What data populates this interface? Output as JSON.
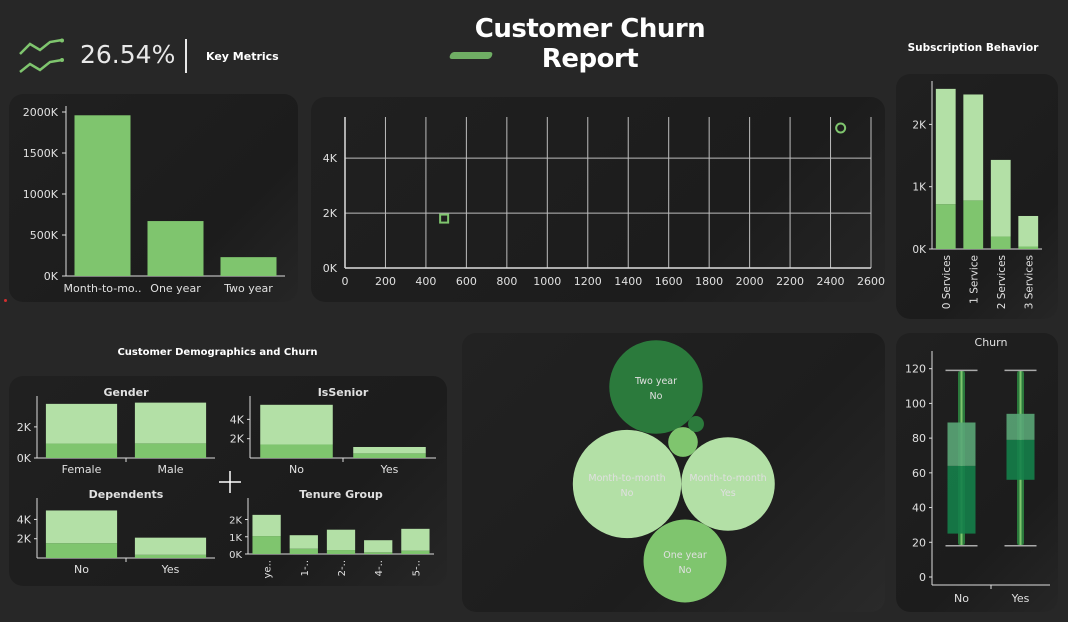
{
  "header": {
    "title": "Customer Churn Report",
    "kpi_value": "26.54%",
    "kpi_label": "Key Metrics",
    "subscription_title": "Subscription Behavior",
    "demographics_title": "Customer Demographics and Churn"
  },
  "colors": {
    "light": "#b3e0a6",
    "mid": "#7fc56e",
    "dark": "#2b7a3c",
    "bg": "#272727",
    "panel": "#1e1e1e"
  },
  "icons": {
    "kpi": "line-chart-icon",
    "cursor": "crosshair-icon"
  },
  "chart_data": [
    {
      "id": "contract",
      "type": "bar",
      "categories": [
        "Month-to-mo..",
        "One year",
        "Two year"
      ],
      "values": [
        1960000,
        670000,
        230000
      ],
      "ylim": [
        0,
        2000000
      ],
      "yticks": [
        {
          "v": 0,
          "label": "0K"
        },
        {
          "v": 500000,
          "label": "500K"
        },
        {
          "v": 1000000,
          "label": "1000K"
        },
        {
          "v": 1500000,
          "label": "1500K"
        },
        {
          "v": 2000000,
          "label": "2000K"
        }
      ]
    },
    {
      "id": "scatter",
      "type": "scatter",
      "points": [
        {
          "x": 490,
          "y": 1800,
          "shape": "square"
        },
        {
          "x": 2450,
          "y": 5100,
          "shape": "circle"
        }
      ],
      "xlim": [
        0,
        2600
      ],
      "ylim": [
        0,
        5500
      ],
      "xticks": [
        0,
        200,
        400,
        600,
        800,
        1000,
        1200,
        1400,
        1600,
        1800,
        2000,
        2200,
        2400,
        2600
      ],
      "yticks": [
        {
          "v": 0,
          "label": "0K"
        },
        {
          "v": 2000,
          "label": "2K"
        },
        {
          "v": 4000,
          "label": "4K"
        }
      ],
      "grid": true
    },
    {
      "id": "subscription",
      "type": "bar",
      "stacked": true,
      "categories": [
        "0 Services",
        "1 Service",
        "2 Services",
        "3 Services"
      ],
      "series": [
        {
          "values": [
            720,
            780,
            200,
            40
          ]
        },
        {
          "values": [
            1850,
            1700,
            1230,
            490
          ]
        }
      ],
      "ylim": [
        0,
        2600
      ],
      "yticks": [
        {
          "v": 0,
          "label": "0K"
        },
        {
          "v": 1000,
          "label": "1K"
        },
        {
          "v": 2000,
          "label": "2K"
        }
      ]
    },
    {
      "id": "gender",
      "type": "bar",
      "stacked": true,
      "title": "Gender",
      "categories": [
        "Female",
        "Male"
      ],
      "series": [
        {
          "values": [
            930,
            940
          ]
        },
        {
          "values": [
            2550,
            2620
          ]
        }
      ],
      "ylim": [
        0,
        3600
      ],
      "yticks": [
        {
          "v": 0,
          "label": "0K"
        },
        {
          "v": 2000,
          "label": "2K"
        }
      ]
    },
    {
      "id": "senior",
      "type": "bar",
      "stacked": true,
      "title": "IsSenior",
      "categories": [
        "No",
        "Yes"
      ],
      "series": [
        {
          "values": [
            1400,
            480
          ]
        },
        {
          "values": [
            4110,
            660
          ]
        }
      ],
      "ylim": [
        0,
        5800
      ],
      "yticks": [
        {
          "v": 2000,
          "label": "2K"
        },
        {
          "v": 4000,
          "label": "4K"
        }
      ]
    },
    {
      "id": "dependents",
      "type": "bar",
      "stacked": true,
      "title": "Dependents",
      "categories": [
        "No",
        "Yes"
      ],
      "series": [
        {
          "values": [
            1540,
            330
          ]
        },
        {
          "values": [
            3390,
            1780
          ]
        }
      ],
      "ylim": [
        0,
        5600
      ],
      "yticks": [
        {
          "v": 2000,
          "label": "2K"
        },
        {
          "v": 4000,
          "label": "4K"
        }
      ]
    },
    {
      "id": "tenure",
      "type": "bar",
      "stacked": true,
      "title": "Tenure Group",
      "categories": [
        "0-1 ye..",
        "1-..",
        "2-..",
        "4-..",
        "5-.."
      ],
      "series": [
        {
          "values": [
            1040,
            310,
            230,
            100,
            190
          ]
        },
        {
          "values": [
            1230,
            780,
            1180,
            700,
            1270
          ]
        }
      ],
      "ylim": [
        0,
        2900
      ],
      "yticks": [
        {
          "v": 0,
          "label": "0K"
        },
        {
          "v": 1000,
          "label": "1K"
        },
        {
          "v": 2000,
          "label": "2K"
        }
      ]
    },
    {
      "id": "bubbles",
      "type": "bubble",
      "bubbles": [
        {
          "line1": "Two year",
          "line2": "No",
          "size": 1650,
          "color": "dark"
        },
        {
          "line1": "Month-to-month",
          "line2": "No",
          "size": 2220,
          "color": "light"
        },
        {
          "line1": "Month-to-month",
          "line2": "Yes",
          "size": 1655,
          "color": "light"
        },
        {
          "line1": "One year",
          "line2": "No",
          "size": 1300,
          "color": "mid"
        },
        {
          "line1": "",
          "line2": "",
          "size": 166,
          "color": "mid"
        },
        {
          "line1": "",
          "line2": "",
          "size": 48,
          "color": "dark"
        }
      ]
    },
    {
      "id": "churn_box",
      "type": "box",
      "title": "Churn",
      "categories": [
        "No",
        "Yes"
      ],
      "boxes": [
        {
          "min": 18,
          "q1": 25,
          "median": 64,
          "q3": 89,
          "max": 119
        },
        {
          "min": 18,
          "q1": 56,
          "median": 79,
          "q3": 94,
          "max": 119
        }
      ],
      "ylim": [
        0,
        125
      ],
      "yticks": [
        0,
        20,
        40,
        60,
        80,
        100,
        120
      ]
    }
  ]
}
